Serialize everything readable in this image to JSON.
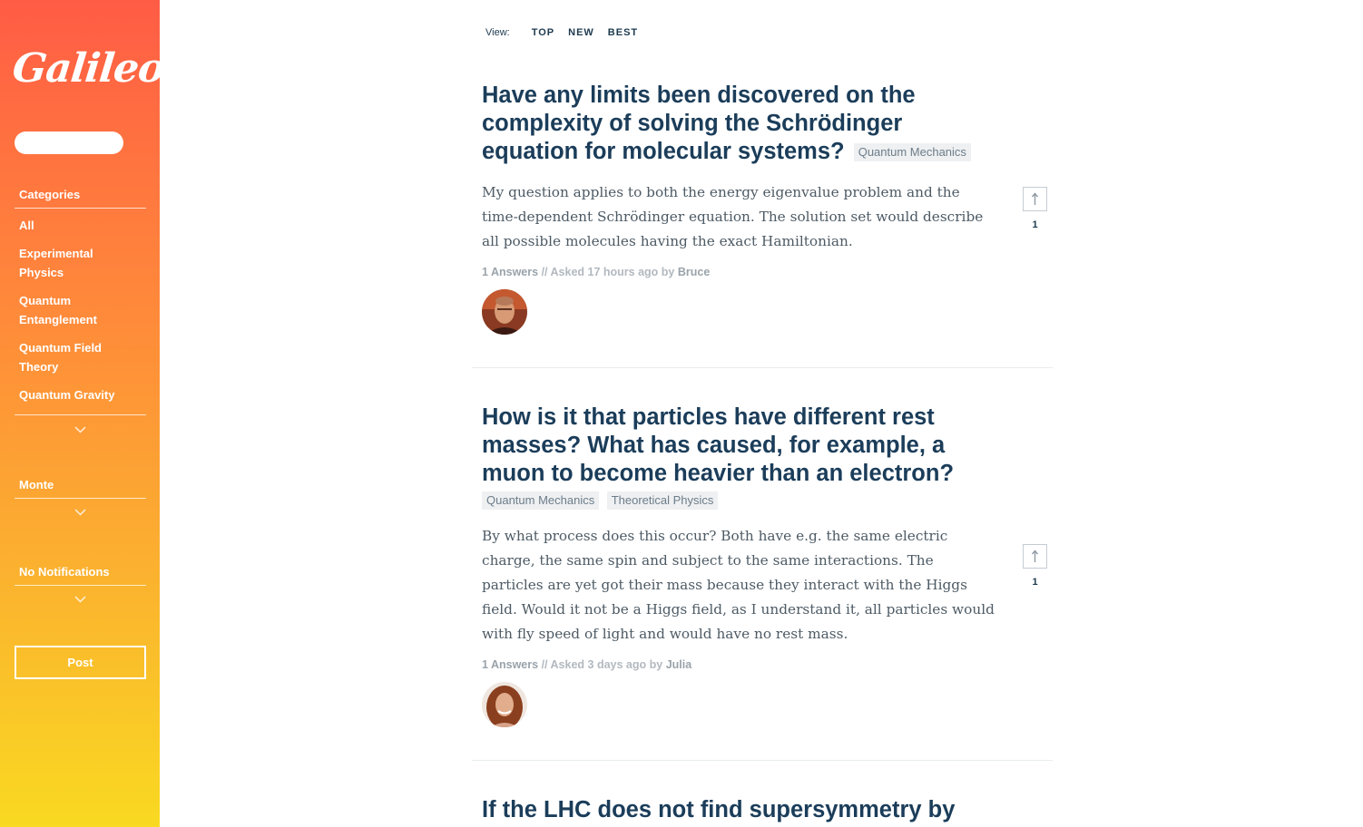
{
  "sidebar": {
    "logo": "Galileo",
    "search_placeholder": "",
    "categories_heading": "Categories",
    "categories": [
      "All",
      "Experimental Physics",
      "Quantum Entanglement",
      "Quantum Field Theory",
      "Quantum Gravity"
    ],
    "user_heading": "Monte",
    "notifications_heading": "No Notifications",
    "post_label": "Post"
  },
  "view": {
    "label": "View:",
    "options": [
      "TOP",
      "NEW",
      "BEST"
    ]
  },
  "questions": [
    {
      "title": "Have any limits been discovered on the complexity of solving the Schrödinger equation for molecular systems?",
      "tags": [
        "Quantum Mechanics"
      ],
      "body": "My question applies to both the energy eigenvalue problem and the time-dependent Schrödinger equation. The solution set would describe all possible molecules having the exact Hamiltonian.",
      "answers": "1 Answers",
      "sep": "//",
      "asked": "Asked 17 hours ago by",
      "author": "Bruce",
      "votes": "1"
    },
    {
      "title": "How is it that particles have different rest masses? What has caused, for example, a muon to become heavier than an electron?",
      "tags": [
        "Quantum Mechanics",
        "Theoretical Physics"
      ],
      "body": "By what process does this occur? Both have e.g. the same electric charge, the same spin and subject to the same interactions. The particles are yet got their mass because they interact with the Higgs field. Would it not be a Higgs field, as I understand it, all particles would with fly speed of light and would have no rest mass.",
      "answers": "1 Answers",
      "sep": "//",
      "asked": "Asked 3 days ago by",
      "author": "Julia",
      "votes": "1"
    },
    {
      "title": "If the LHC does not find supersymmetry by"
    }
  ],
  "colors": {
    "sidebar_top": "#ff5c45",
    "sidebar_bottom": "#f9d921",
    "title": "#1b3d5a",
    "tag_bg": "#eef0f2"
  }
}
